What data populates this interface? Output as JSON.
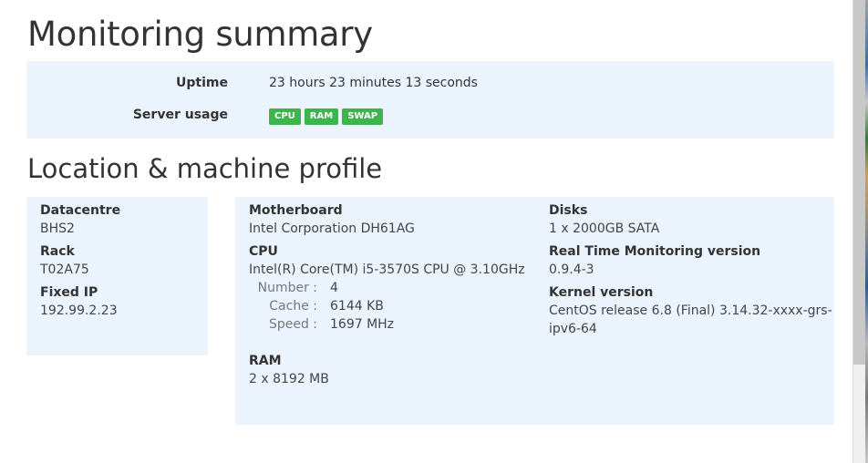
{
  "summary": {
    "title": "Monitoring summary",
    "uptime_label": "Uptime",
    "uptime_value": "23 hours 23 minutes 13 seconds",
    "usage_label": "Server usage",
    "usage_badges": [
      "CPU",
      "RAM",
      "SWAP"
    ],
    "badge_color": "#3eb54c"
  },
  "profile": {
    "title": "Location & machine profile",
    "location": {
      "datacentre_label": "Datacentre",
      "datacentre": "BHS2",
      "rack_label": "Rack",
      "rack": "T02A75",
      "ip_label": "Fixed IP",
      "ip": "192.99.2.23"
    },
    "machine": {
      "motherboard_label": "Motherboard",
      "motherboard": "Intel Corporation DH61AG",
      "cpu_label": "CPU",
      "cpu": "Intel(R) Core(TM) i5-3570S CPU @ 3.10GHz",
      "cpu_number_label": "Number :",
      "cpu_number": "4",
      "cpu_cache_label": "Cache :",
      "cpu_cache": "6144 KB",
      "cpu_speed_label": "Speed :",
      "cpu_speed": "1697 MHz",
      "ram_label": "RAM",
      "ram": "2 x 8192 MB",
      "disks_label": "Disks",
      "disks": "1 x 2000GB SATA",
      "rtm_label": "Real Time Monitoring version",
      "rtm": "0.9.4-3",
      "kernel_label": "Kernel version",
      "kernel_line1": "CentOS release 6.8 (Final) 3.14.32-xxxx-grs-",
      "kernel_line2": "ipv6-64"
    }
  },
  "colors": {
    "panel_bg": "#ebf4fd",
    "text": "#333333"
  }
}
